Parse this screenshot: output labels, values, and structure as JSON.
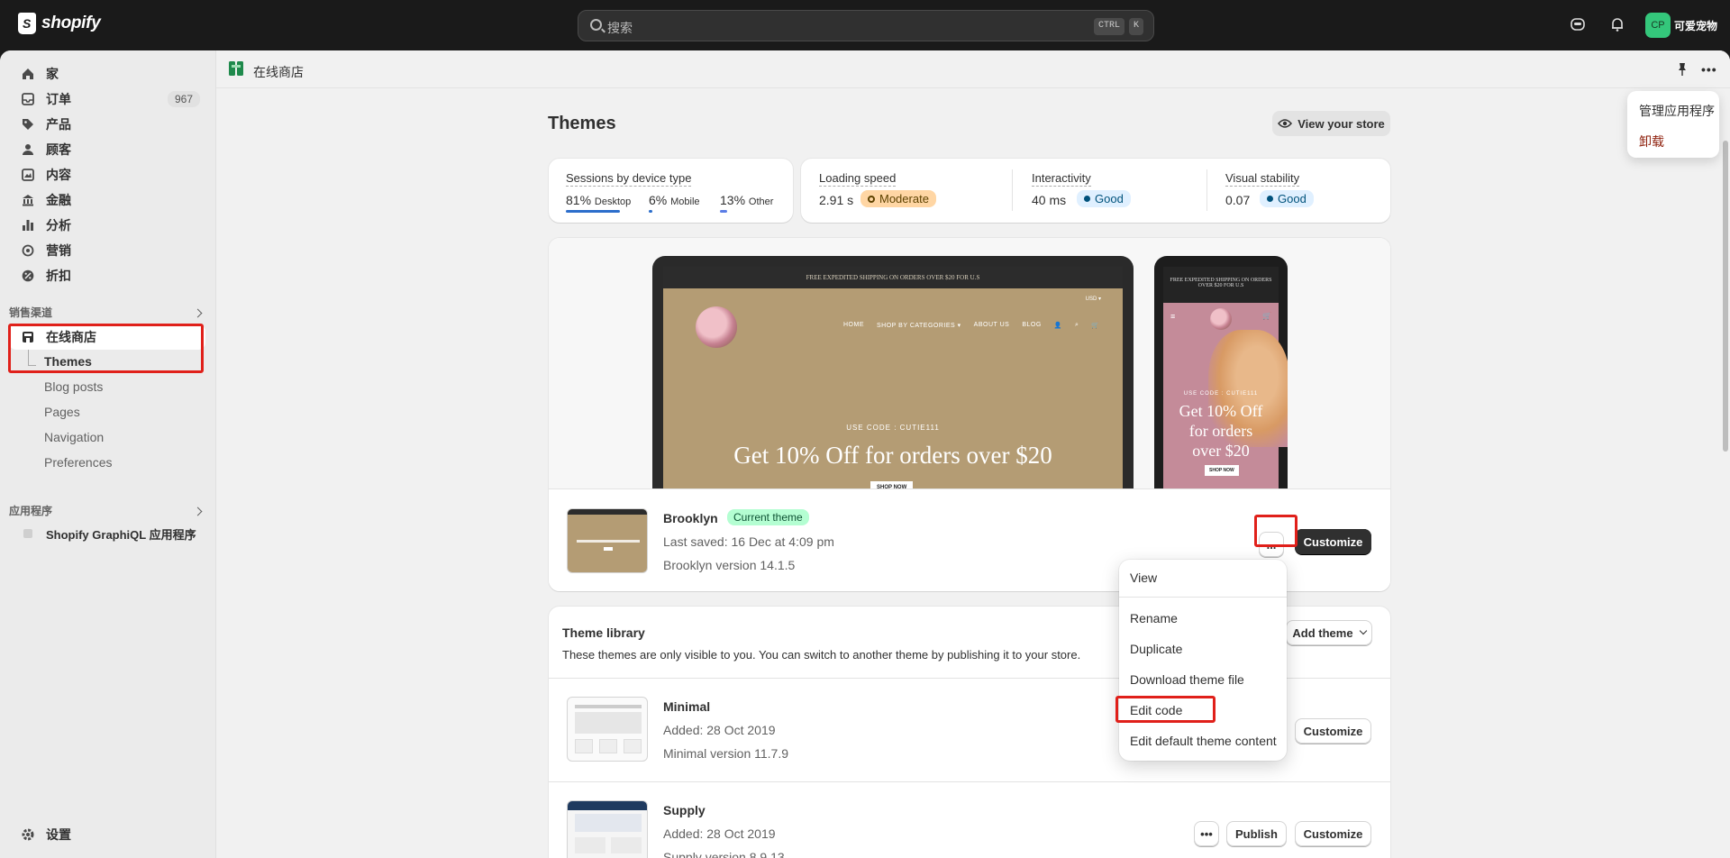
{
  "topbar": {
    "brand": "shopify",
    "search_placeholder": "搜索",
    "kbd_ctrl": "CTRL",
    "kbd_k": "K",
    "avatar_initials": "CP",
    "store_name": "可爱宠物"
  },
  "sidebar": {
    "items": [
      {
        "label": "家",
        "icon": "home-icon"
      },
      {
        "label": "订单",
        "icon": "orders-icon",
        "count": "967"
      },
      {
        "label": "产品",
        "icon": "tag-icon"
      },
      {
        "label": "顾客",
        "icon": "person-icon"
      },
      {
        "label": "内容",
        "icon": "content-icon"
      },
      {
        "label": "金融",
        "icon": "bank-icon"
      },
      {
        "label": "分析",
        "icon": "chart-icon"
      },
      {
        "label": "营销",
        "icon": "target-icon"
      },
      {
        "label": "折扣",
        "icon": "discount-icon"
      }
    ],
    "sales_channels_title": "销售渠道",
    "online_store": "在线商店",
    "sub_items": [
      "Themes",
      "Blog posts",
      "Pages",
      "Navigation",
      "Preferences"
    ],
    "apps_title": "应用程序",
    "app_item": "Shopify GraphiQL 应用程序",
    "settings": "设置"
  },
  "header": {
    "app_title": "在线商店"
  },
  "app_menu": {
    "manage": "管理应用程序",
    "uninstall": "卸载"
  },
  "page": {
    "title": "Themes",
    "view_store": "View your store"
  },
  "metrics": {
    "sessions_label": "Sessions by device type",
    "desktop_pct": "81%",
    "desktop_lbl": "Desktop",
    "mobile_pct": "6%",
    "mobile_lbl": "Mobile",
    "other_pct": "13%",
    "other_lbl": "Other",
    "loading_label": "Loading speed",
    "loading_val": "2.91 s",
    "loading_badge": "Moderate",
    "interactivity_label": "Interactivity",
    "interactivity_val": "40 ms",
    "interactivity_badge": "Good",
    "visual_label": "Visual stability",
    "visual_val": "0.07",
    "visual_badge": "Good"
  },
  "preview": {
    "shipping_strip": "FREE EXPEDITED SHIPPING ON ORDERS OVER $20 FOR U.S",
    "currency": "USD ▾",
    "menu": [
      "HOME",
      "SHOP BY CATEGORIES ▾",
      "ABOUT US",
      "BLOG"
    ],
    "use_code": "USE CODE : CUTIE111",
    "promo": "Get 10% Off for orders over $20",
    "shop_now": "SHOP NOW",
    "mobile_promo_1": "Get 10% Off",
    "mobile_promo_2": "for orders",
    "mobile_promo_3": "over $20"
  },
  "current_theme": {
    "name": "Brooklyn",
    "badge": "Current theme",
    "saved": "Last saved: 16 Dec at 4:09 pm",
    "version": "Brooklyn version 14.1.5",
    "more": "...",
    "customize": "Customize"
  },
  "menu": {
    "items": [
      "View",
      "Rename",
      "Duplicate",
      "Download theme file",
      "Edit code",
      "Edit default theme content"
    ]
  },
  "library": {
    "title": "Theme library",
    "description": "These themes are only visible to you. You can switch to another theme by publishing it to your store.",
    "add_theme": "Add theme",
    "themes": [
      {
        "name": "Minimal",
        "added": "Added: 28 Oct 2019",
        "version": "Minimal version 11.7.9",
        "customize": "Customize"
      },
      {
        "name": "Supply",
        "added": "Added: 28 Oct 2019",
        "version": "Supply version 8.9.13",
        "publish": "Publish",
        "customize": "Customize"
      }
    ]
  }
}
